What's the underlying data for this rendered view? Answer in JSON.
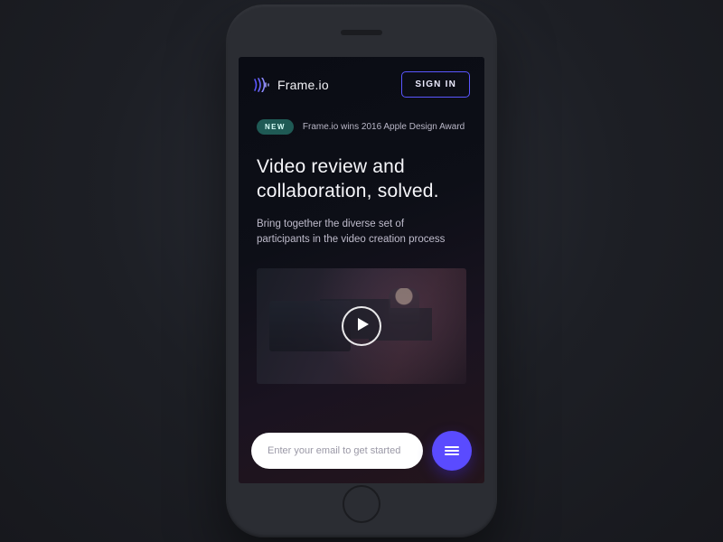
{
  "header": {
    "brand": "Frame.io",
    "signin_label": "SIGN IN"
  },
  "announcement": {
    "badge": "NEW",
    "text": "Frame.io wins 2016 Apple Design Award"
  },
  "hero": {
    "headline": "Video review and collaboration, solved.",
    "subhead": "Bring together the diverse set of participants in the video creation process"
  },
  "video": {
    "play_icon": "play-icon"
  },
  "cta": {
    "email_placeholder": "Enter your email to get started"
  },
  "colors": {
    "accent": "#5a4bff",
    "badge": "#1f5a55"
  }
}
